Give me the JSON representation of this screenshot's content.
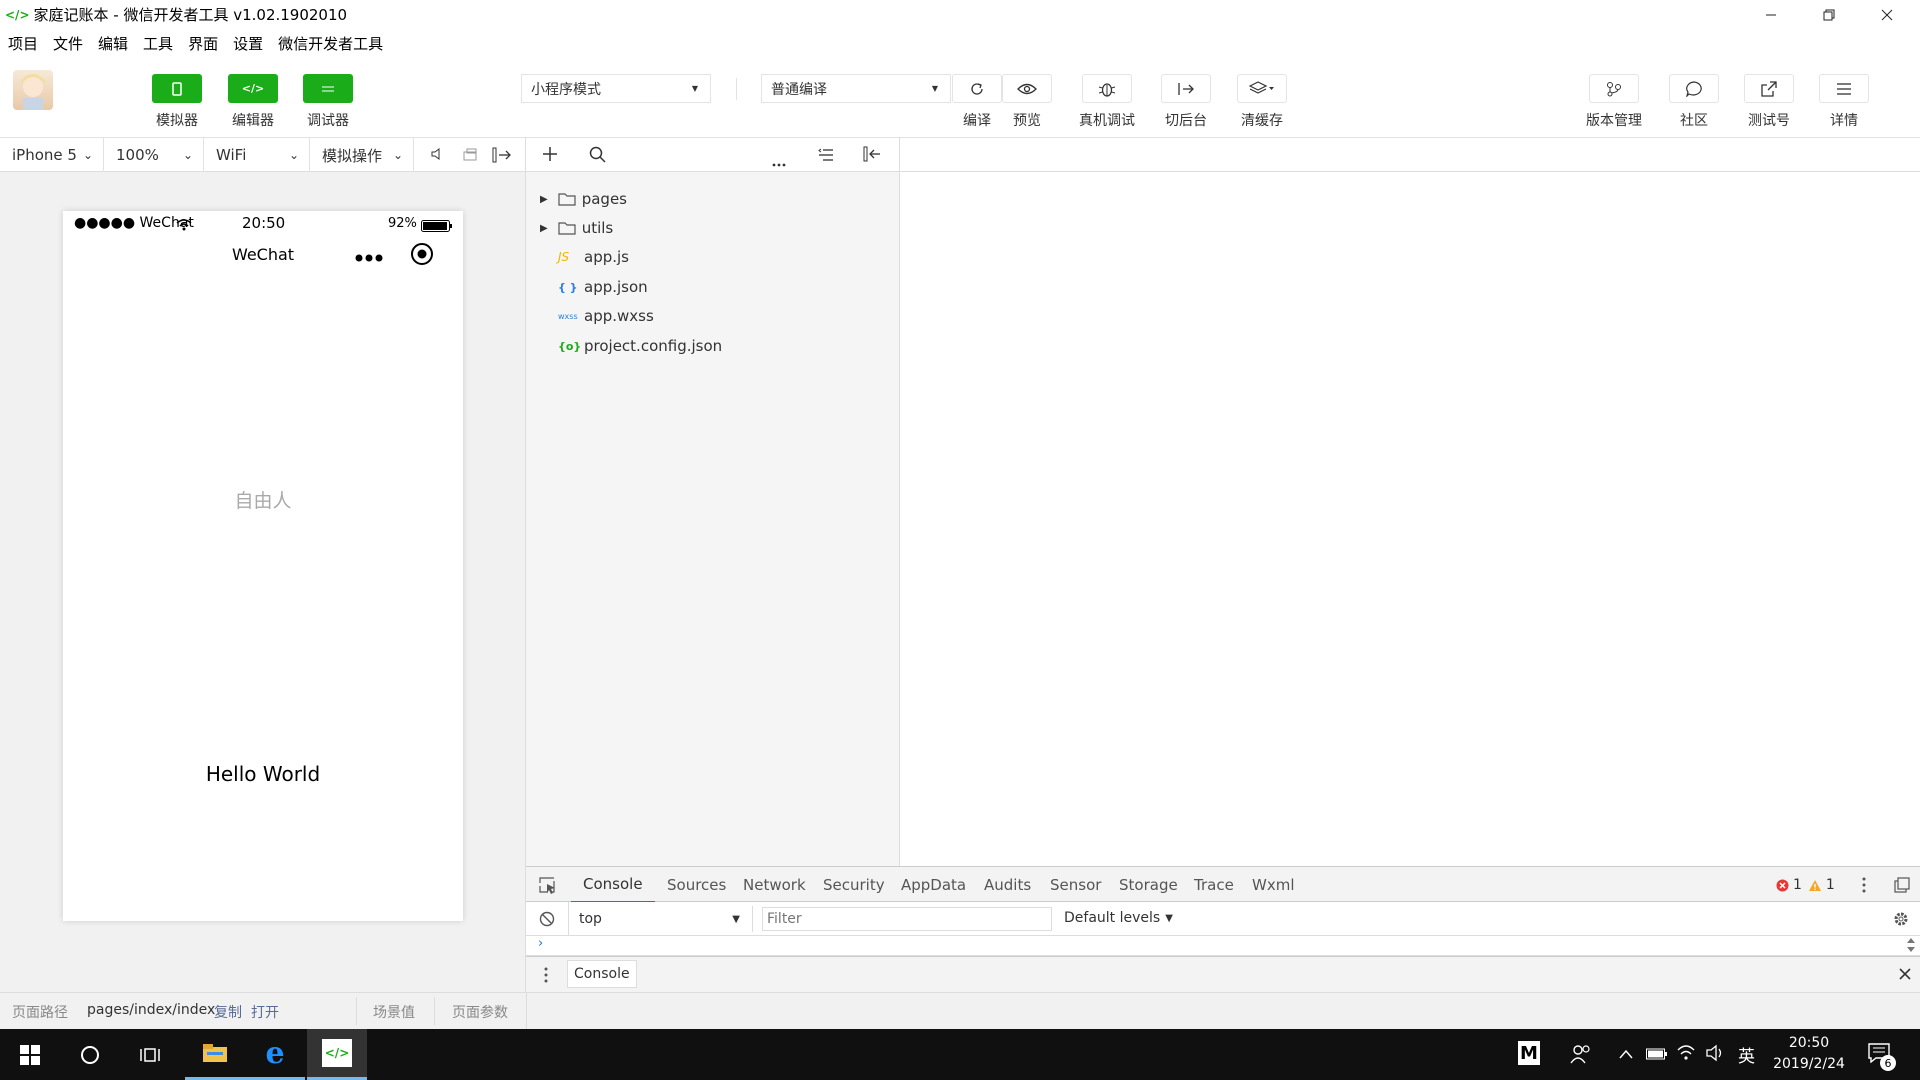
{
  "window": {
    "title": "家庭记账本 - 微信开发者工具 v1.02.1902010",
    "logo": "</>"
  },
  "menu": [
    "项目",
    "文件",
    "编辑",
    "工具",
    "界面",
    "设置",
    "微信开发者工具"
  ],
  "toolbar": {
    "simulator": "模拟器",
    "editor": "编辑器",
    "debugger": "调试器",
    "mode": "小程序模式",
    "compile_mode": "普通编译",
    "compile": "编译",
    "preview": "预览",
    "remote_debug": "真机调试",
    "background": "切后台",
    "clear_cache": "清缓存",
    "version": "版本管理",
    "community": "社区",
    "test_account": "测试号",
    "details": "详情"
  },
  "device_bar": {
    "device": "iPhone 5",
    "zoom": "100%",
    "network": "WiFi",
    "sim_ops": "模拟操作"
  },
  "phone": {
    "carrier": "●●●●● WeChat",
    "time": "20:50",
    "battery": "92%",
    "nav_title": "WeChat",
    "username": "自由人",
    "greeting": "Hello World"
  },
  "file_tree": [
    {
      "name": "pages",
      "type": "folder"
    },
    {
      "name": "utils",
      "type": "folder"
    },
    {
      "name": "app.js",
      "type": "js",
      "badge": "JS"
    },
    {
      "name": "app.json",
      "type": "json",
      "badge": "{ }"
    },
    {
      "name": "app.wxss",
      "type": "wxss",
      "badge": "wxss"
    },
    {
      "name": "project.config.json",
      "type": "config",
      "badge": "{o}"
    }
  ],
  "console": {
    "tabs": [
      "Console",
      "Sources",
      "Network",
      "Security",
      "AppData",
      "Audits",
      "Sensor",
      "Storage",
      "Trace",
      "Wxml"
    ],
    "active_tab": "Console",
    "errors": "1",
    "warnings": "1",
    "context": "top",
    "filter_placeholder": "Filter",
    "levels": "Default levels",
    "drawer_tab": "Console"
  },
  "statusbar": {
    "path_label": "页面路径",
    "path": "pages/index/index",
    "copy": "复制",
    "open": "打开",
    "scene": "场景值",
    "params": "页面参数"
  },
  "taskbar": {
    "time": "20:50",
    "date": "2019/2/24",
    "ime": "英",
    "notifications": "6",
    "m_icon": "M"
  },
  "colors": {
    "accent": "#1aad19",
    "link": "#576b95",
    "error": "#e53935",
    "warning": "#f5a623"
  }
}
